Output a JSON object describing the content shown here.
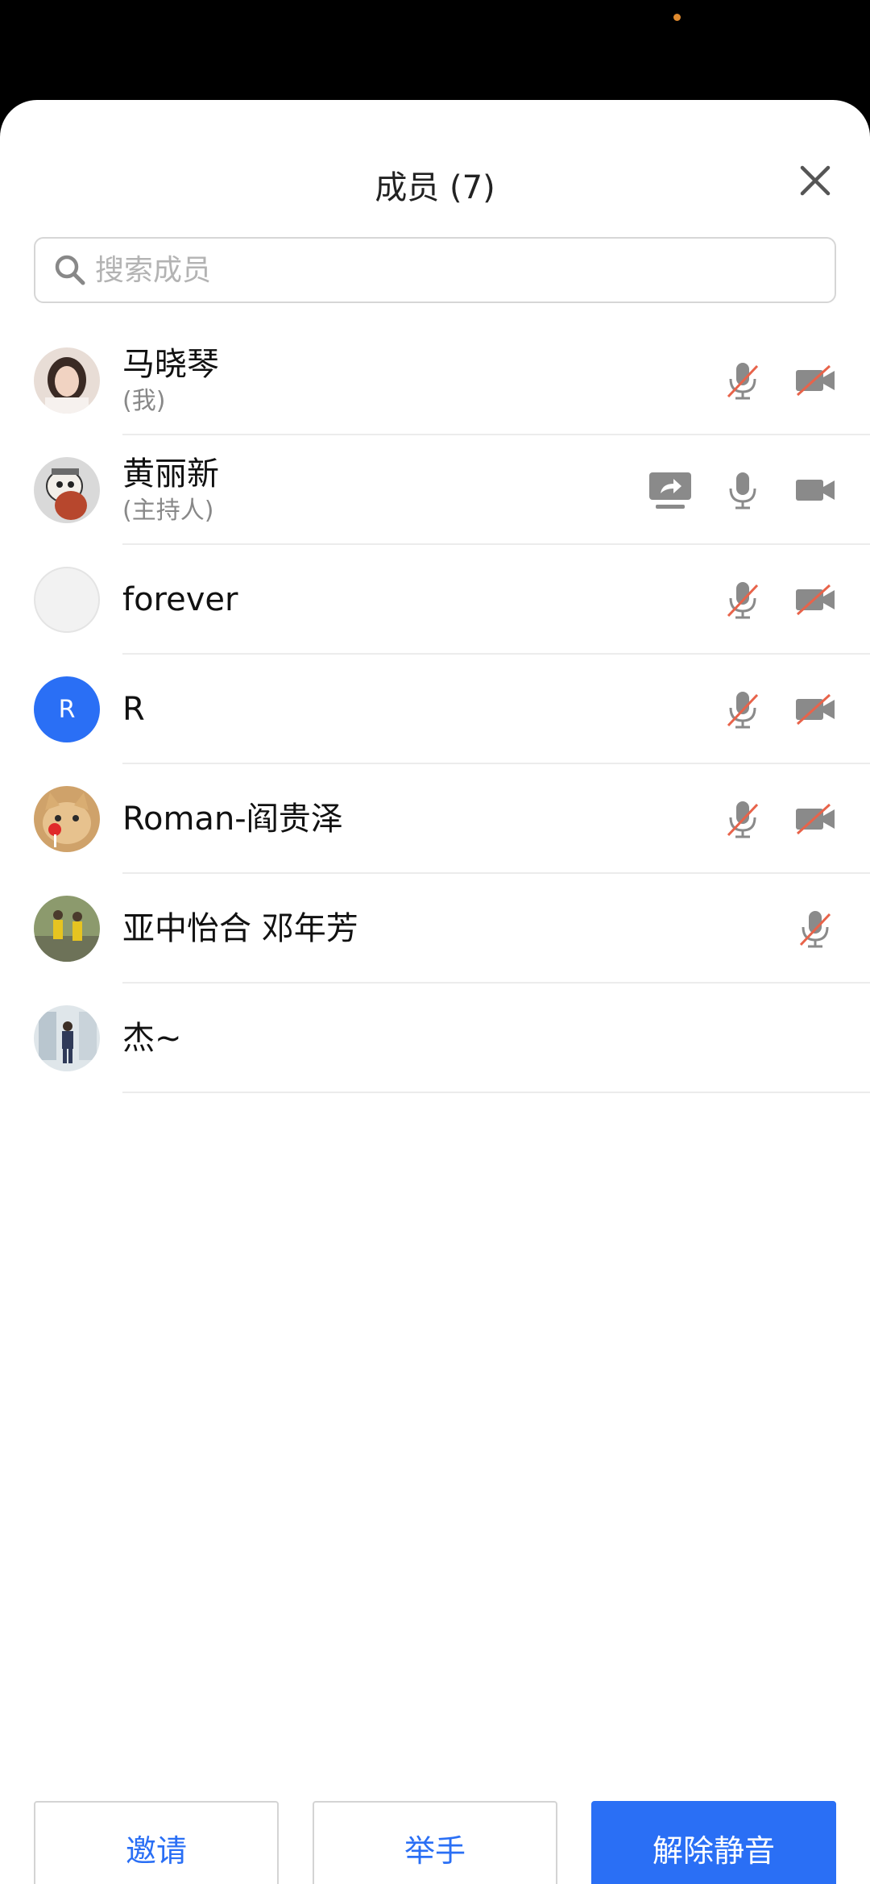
{
  "header": {
    "title": "成员 (7)"
  },
  "search": {
    "placeholder": "搜索成员"
  },
  "members": [
    {
      "name": "马晓琴",
      "role": "(我)",
      "avatar": "photo",
      "screen_share": false,
      "mic": "muted",
      "camera": "off"
    },
    {
      "name": "黄丽新",
      "role": "(主持人)",
      "avatar": "cartoon",
      "screen_share": true,
      "mic": "on",
      "camera": "on"
    },
    {
      "name": "forever",
      "role": "",
      "avatar": "empty",
      "screen_share": false,
      "mic": "muted",
      "camera": "off"
    },
    {
      "name": "R",
      "role": "",
      "avatar": "letter",
      "avatar_letter": "R",
      "screen_share": false,
      "mic": "muted",
      "camera": "off"
    },
    {
      "name": "Roman-阎贵泽",
      "role": "",
      "avatar": "cat",
      "screen_share": false,
      "mic": "muted",
      "camera": "off"
    },
    {
      "name": "亚中怡合 邓年芳",
      "role": "",
      "avatar": "photo",
      "screen_share": false,
      "mic": "muted",
      "camera": "none"
    },
    {
      "name": "杰~",
      "role": "",
      "avatar": "photo",
      "screen_share": false,
      "mic": "none",
      "camera": "none"
    }
  ],
  "footer": {
    "invite_label": "邀请",
    "raise_hand_label": "举手",
    "unmute_label": "解除静音"
  },
  "colors": {
    "accent": "#2a6ff5",
    "muted_slash": "#e8634a",
    "icon_gray": "#888888"
  }
}
